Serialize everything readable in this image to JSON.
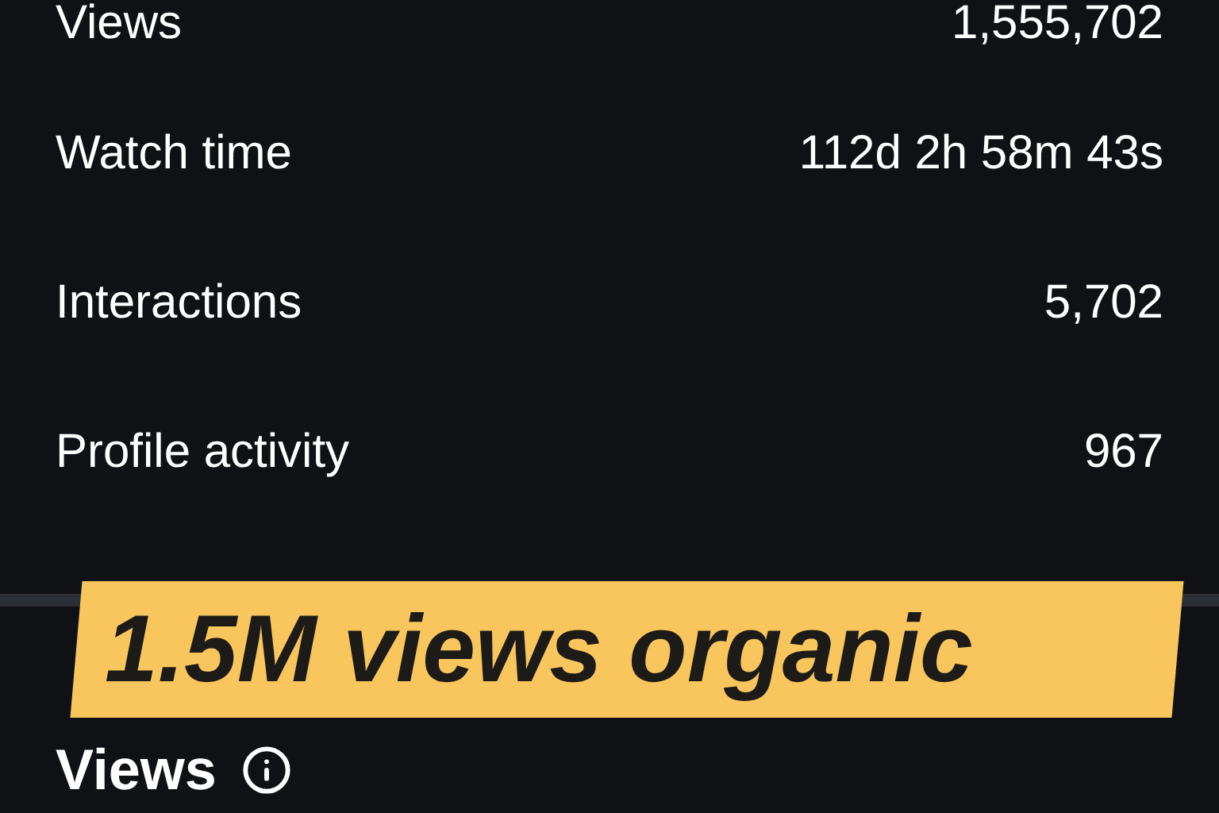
{
  "stats": [
    {
      "label": "Views",
      "value": "1,555,702"
    },
    {
      "label": "Watch time",
      "value": "112d 2h 58m 43s"
    },
    {
      "label": "Interactions",
      "value": "5,702"
    },
    {
      "label": "Profile activity",
      "value": "967"
    }
  ],
  "banner": {
    "text": "1.5M views organic"
  },
  "section": {
    "title": "Views"
  }
}
